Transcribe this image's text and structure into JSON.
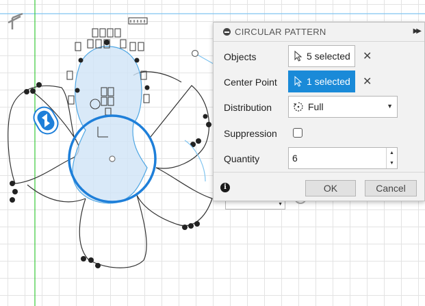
{
  "panel": {
    "title": "CIRCULAR PATTERN",
    "rows": {
      "objects": {
        "label": "Objects",
        "value": "5 selected"
      },
      "center_point": {
        "label": "Center Point",
        "value": "1 selected"
      },
      "distribution": {
        "label": "Distribution",
        "value": "Full"
      },
      "suppression": {
        "label": "Suppression",
        "checked": false
      },
      "quantity": {
        "label": "Quantity",
        "value": "6"
      }
    },
    "footer": {
      "ok_label": "OK",
      "cancel_label": "Cancel",
      "info_symbol": "i"
    }
  },
  "icons": {
    "collapse": "minus-circle-icon",
    "expand": "double-chevron-right-icon",
    "select": "cursor-arrow-icon",
    "clear": "close-icon",
    "distribution": "rotate-icon",
    "info": "info-icon"
  },
  "colors": {
    "accent_blue": "#1a8ad8",
    "sketch_line": "#333333",
    "selection_blue": "#1e7fd9",
    "green_axis": "#37c837",
    "fill_light_blue": "#cfe4f6"
  }
}
